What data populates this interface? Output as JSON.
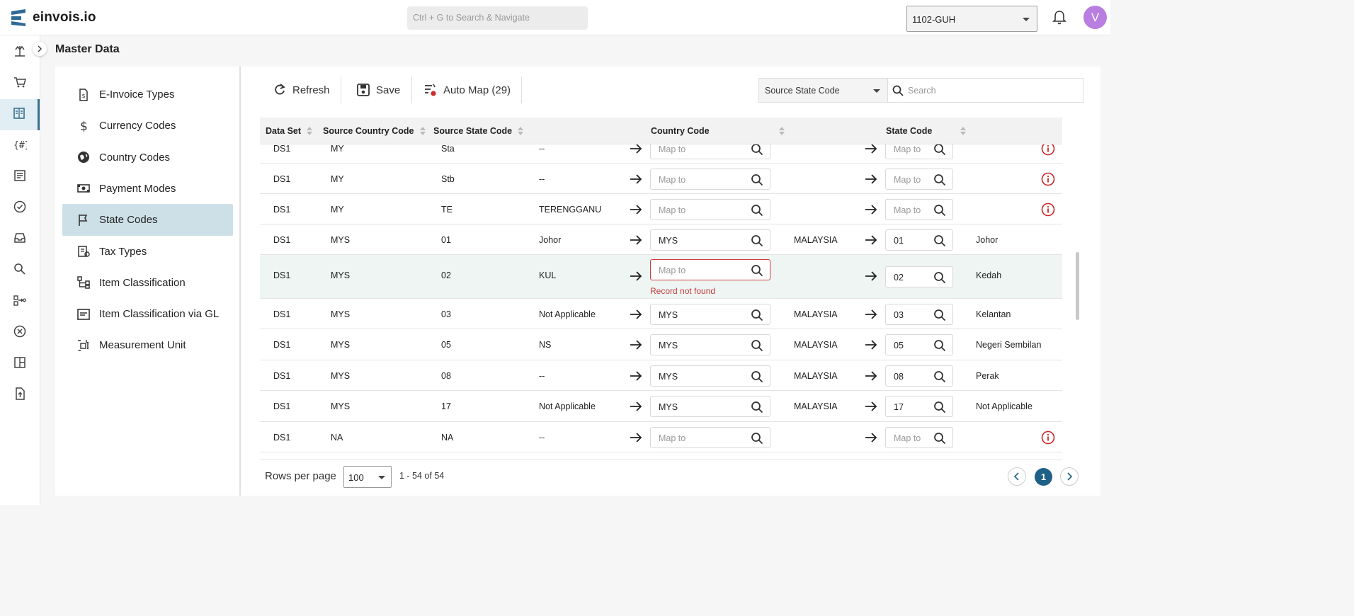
{
  "app": {
    "name": "einvois.io",
    "search_placeholder": "Ctrl + G to Search & Navigate",
    "org": "1102-GUH",
    "avatar_letter": "V"
  },
  "page": {
    "title": "Master Data"
  },
  "rail_icons": [
    "scales-icon",
    "cart-icon",
    "book-icon",
    "code-icon",
    "list-icon",
    "check-circle-icon",
    "inbox-icon",
    "search-icon",
    "flow-icon",
    "cancel-circle-icon",
    "layout-icon",
    "upload-file-icon"
  ],
  "nav": [
    {
      "label": "E-Invoice Types",
      "icon": "invoice-icon"
    },
    {
      "label": "Currency Codes",
      "icon": "dollar-icon"
    },
    {
      "label": "Country Codes",
      "icon": "globe-icon"
    },
    {
      "label": "Payment Modes",
      "icon": "money-icon"
    },
    {
      "label": "State Codes",
      "icon": "flag-icon",
      "active": true
    },
    {
      "label": "Tax Types",
      "icon": "tax-icon"
    },
    {
      "label": "Item Classification",
      "icon": "hierarchy-icon"
    },
    {
      "label": "Item Classification via GL",
      "icon": "ledger-icon"
    },
    {
      "label": "Measurement Unit",
      "icon": "ruler-icon"
    }
  ],
  "toolbar": {
    "refresh": "Refresh",
    "save": "Save",
    "automap": "Auto Map (29)",
    "filter_field": "Source State Code",
    "search_placeholder": "Search"
  },
  "columns": {
    "dataset": "Data Set",
    "src_country": "Source Country Code",
    "src_state": "Source State Code",
    "country": "Country Code",
    "state": "State Code"
  },
  "placeholder": "Map to",
  "rows": [
    {
      "ds": "DS1",
      "sc": "MY",
      "ss": "Sta",
      "desc": "--",
      "country": "",
      "country_name": "",
      "state": "",
      "state_name": "",
      "warn": true
    },
    {
      "ds": "DS1",
      "sc": "MY",
      "ss": "Stb",
      "desc": "--",
      "country": "",
      "country_name": "",
      "state": "",
      "state_name": "",
      "warn": true
    },
    {
      "ds": "DS1",
      "sc": "MY",
      "ss": "TE",
      "desc": "TERENGGANU",
      "country": "",
      "country_name": "",
      "state": "",
      "state_name": "",
      "warn": true
    },
    {
      "ds": "DS1",
      "sc": "MYS",
      "ss": "01",
      "desc": "Johor",
      "country": "MYS",
      "country_name": "MALAYSIA",
      "state": "01",
      "state_name": "Johor",
      "warn": false
    },
    {
      "ds": "DS1",
      "sc": "MYS",
      "ss": "02",
      "desc": "KUL",
      "country": "",
      "country_name": "",
      "state": "02",
      "state_name": "Kedah",
      "warn": false,
      "error": "Record not found"
    },
    {
      "ds": "DS1",
      "sc": "MYS",
      "ss": "03",
      "desc": "Not Applicable",
      "country": "MYS",
      "country_name": "MALAYSIA",
      "state": "03",
      "state_name": "Kelantan",
      "warn": false
    },
    {
      "ds": "DS1",
      "sc": "MYS",
      "ss": "05",
      "desc": "NS",
      "country": "MYS",
      "country_name": "MALAYSIA",
      "state": "05",
      "state_name": "Negeri Sembilan",
      "warn": false
    },
    {
      "ds": "DS1",
      "sc": "MYS",
      "ss": "08",
      "desc": "--",
      "country": "MYS",
      "country_name": "MALAYSIA",
      "state": "08",
      "state_name": "Perak",
      "warn": false
    },
    {
      "ds": "DS1",
      "sc": "MYS",
      "ss": "17",
      "desc": "Not Applicable",
      "country": "MYS",
      "country_name": "MALAYSIA",
      "state": "17",
      "state_name": "Not Applicable",
      "warn": false
    },
    {
      "ds": "DS1",
      "sc": "NA",
      "ss": "NA",
      "desc": "--",
      "country": "",
      "country_name": "",
      "state": "",
      "state_name": "",
      "warn": true
    }
  ],
  "footer": {
    "rows_per_page_label": "Rows per page",
    "rows_per_page": "100",
    "range": "1 - 54 of 54",
    "page": "1"
  },
  "colors": {
    "accent": "#1f6087",
    "active_nav": "#cde0e8",
    "error": "#c43a3a"
  }
}
